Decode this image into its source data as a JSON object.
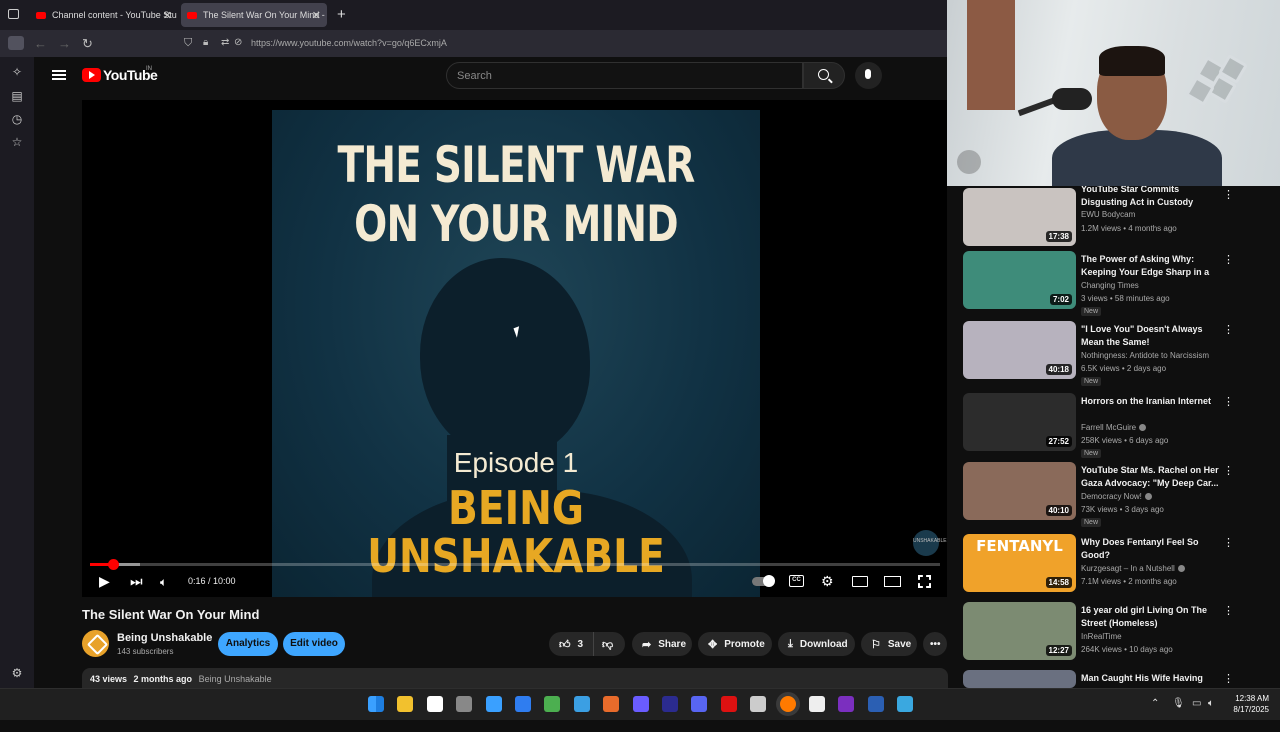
{
  "browser": {
    "tabs": [
      {
        "label": "Channel content - YouTube Stu",
        "active": false
      },
      {
        "label": "The Silent War On Your Mind -",
        "active": true
      }
    ],
    "new_tab": "+",
    "url": "https://www.youtube.com/watch?v=go/q6ECxmjA"
  },
  "youtube": {
    "logo_text": "YouTube",
    "region": "IN",
    "search_placeholder": "Search"
  },
  "video": {
    "thumbnail": {
      "title_line1": "THE SILENT WAR",
      "title_line2": "ON YOUR MIND",
      "episode": "Episode 1",
      "brand_line1": "BEING",
      "brand_line2": "UNSHAKABLE",
      "watermark": "UNSHAKABLE"
    },
    "time_display": "0:16 / 10:00",
    "progress_fraction": 0.027,
    "title": "The Silent War On Your Mind",
    "channel_name": "Being Unshakable",
    "subscribers": "143 subscribers",
    "analytics_label": "Analytics",
    "edit_label": "Edit video",
    "likes": "3",
    "share_label": "Share",
    "promote_label": "Promote",
    "download_label": "Download",
    "save_label": "Save",
    "views": "43 views",
    "age": "2 months ago",
    "desc_channel": "Being Unshakable"
  },
  "recommendations": [
    {
      "title": "YouTube Star Commits Disgusting Act in Custody",
      "channel": "EWU Bodycam",
      "verified": false,
      "meta": "1.2M views • 4 months ago",
      "duration": "17:38",
      "new": false,
      "thumb_color": "#c9c3c0"
    },
    {
      "title": "The Power of Asking Why: Keeping Your Edge Sharp in a ...",
      "channel": "Changing Times",
      "verified": false,
      "meta": "3 views • 58 minutes ago",
      "duration": "7:02",
      "new": true,
      "thumb_color": "#3e8c7a"
    },
    {
      "title": "\"I Love You\" Doesn't Always Mean the Same!",
      "channel": "Nothingness: Antidote to Narcissism",
      "verified": false,
      "meta": "6.5K views • 2 days ago",
      "duration": "40:18",
      "new": true,
      "thumb_color": "#b7b2be"
    },
    {
      "title": "Horrors on the Iranian Internet",
      "channel": "Farrell McGuire",
      "verified": true,
      "meta": "258K views • 6 days ago",
      "duration": "27:52",
      "new": true,
      "thumb_color": "#2c2c2c"
    },
    {
      "title": "YouTube Star Ms. Rachel on Her Gaza Advocacy: \"My Deep Car...",
      "channel": "Democracy Now!",
      "verified": true,
      "meta": "73K views • 3 days ago",
      "duration": "40:10",
      "new": true,
      "thumb_color": "#8a6a5a"
    },
    {
      "title": "Why Does Fentanyl Feel So Good?",
      "channel": "Kurzgesagt – In a Nutshell",
      "verified": true,
      "meta": "7.1M views • 2 months ago",
      "duration": "14:58",
      "new": false,
      "thumb_color": "#f0a22a",
      "thumb_text": "FENTANYL"
    },
    {
      "title": "16 year old girl Living On The Street (Homeless)",
      "channel": "InRealTime",
      "verified": false,
      "meta": "264K views • 10 days ago",
      "duration": "12:27",
      "new": false,
      "thumb_color": "#7c8b72"
    },
    {
      "title": "Man Caught His Wife Having",
      "channel": "",
      "verified": false,
      "meta": "",
      "duration": "",
      "new": false,
      "thumb_color": "#6a7080"
    }
  ],
  "new_badge": "New",
  "taskbar": {
    "time": "12:38 AM",
    "date": "8/17/2025"
  }
}
